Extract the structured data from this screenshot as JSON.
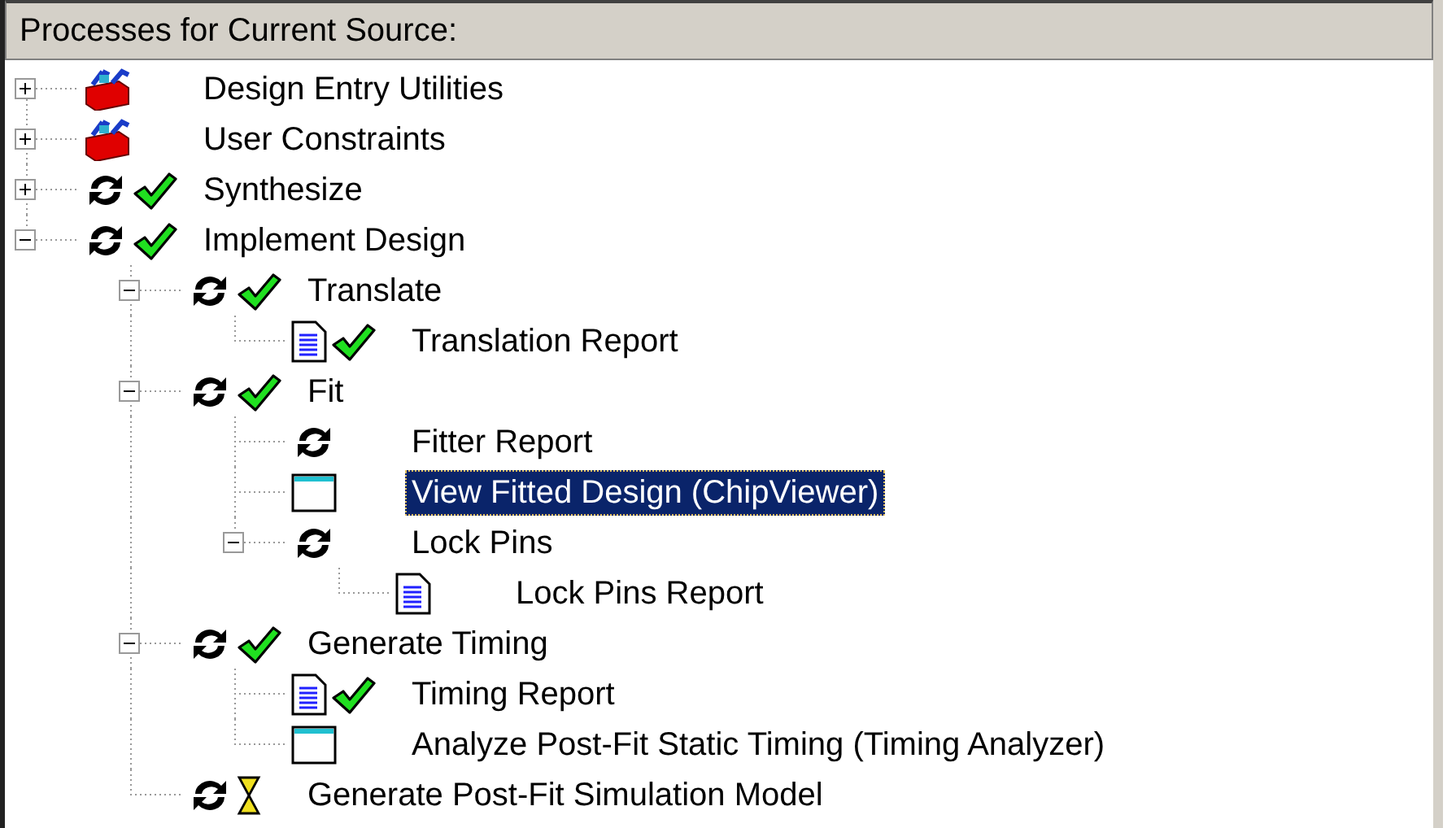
{
  "panel": {
    "title": "Processes for Current Source:"
  },
  "tree": [
    {
      "label": "Design Entry Utilities",
      "kind": "toolbox",
      "done": false,
      "pending": false,
      "selected": false,
      "expanded": false
    },
    {
      "label": "User Constraints",
      "kind": "toolbox",
      "done": false,
      "pending": false,
      "selected": false,
      "expanded": false
    },
    {
      "label": "Synthesize",
      "kind": "process",
      "done": true,
      "pending": false,
      "selected": false,
      "expanded": false
    },
    {
      "label": "Implement Design",
      "kind": "process",
      "done": true,
      "pending": false,
      "selected": false,
      "expanded": true,
      "children": [
        {
          "label": "Translate",
          "kind": "process",
          "done": true,
          "pending": false,
          "selected": false,
          "expanded": true,
          "children": [
            {
              "label": "Translation Report",
              "kind": "report",
              "done": true,
              "pending": false,
              "selected": false
            }
          ]
        },
        {
          "label": "Fit",
          "kind": "process",
          "done": true,
          "pending": false,
          "selected": false,
          "expanded": true,
          "children": [
            {
              "label": "Fitter Report",
              "kind": "process",
              "done": false,
              "pending": false,
              "selected": false
            },
            {
              "label": "View Fitted Design (ChipViewer)",
              "kind": "window",
              "done": false,
              "pending": false,
              "selected": true
            },
            {
              "label": "Lock Pins",
              "kind": "process",
              "done": false,
              "pending": false,
              "selected": false,
              "expanded": true,
              "children": [
                {
                  "label": "Lock Pins Report",
                  "kind": "report",
                  "done": false,
                  "pending": false,
                  "selected": false
                }
              ]
            }
          ]
        },
        {
          "label": "Generate Timing",
          "kind": "process",
          "done": true,
          "pending": false,
          "selected": false,
          "expanded": true,
          "children": [
            {
              "label": "Timing Report",
              "kind": "report",
              "done": true,
              "pending": false,
              "selected": false
            },
            {
              "label": "Analyze Post-Fit Static Timing (Timing Analyzer)",
              "kind": "window",
              "done": false,
              "pending": false,
              "selected": false
            }
          ]
        },
        {
          "label": "Generate Post-Fit Simulation Model",
          "kind": "process",
          "done": false,
          "pending": true,
          "selected": false
        }
      ]
    }
  ]
}
